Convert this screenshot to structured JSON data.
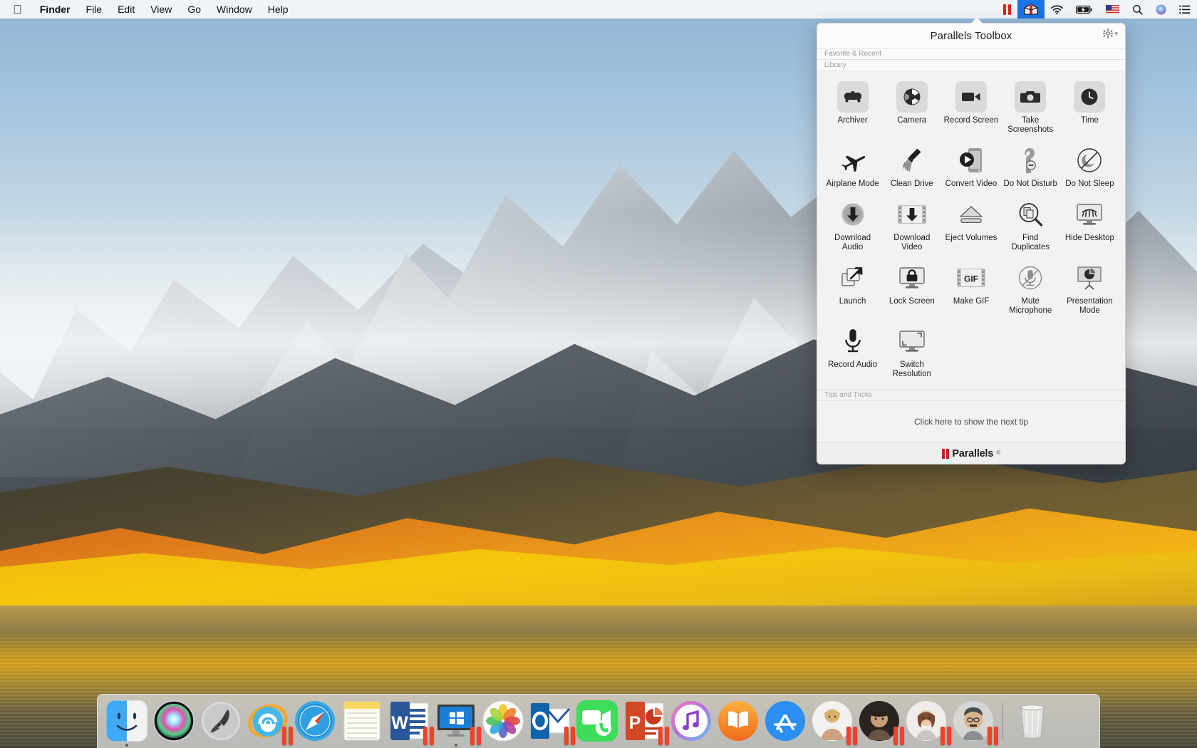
{
  "menubar": {
    "apple_icon": "apple-logo-icon",
    "items": [
      {
        "label": "Finder",
        "bold": true
      },
      {
        "label": "File",
        "bold": false
      },
      {
        "label": "Edit",
        "bold": false
      },
      {
        "label": "View",
        "bold": false
      },
      {
        "label": "Go",
        "bold": false
      },
      {
        "label": "Window",
        "bold": false
      },
      {
        "label": "Help",
        "bold": false
      }
    ],
    "status_items": [
      {
        "name": "parallels-bars-icon",
        "glyph": ""
      },
      {
        "name": "parallels-toolbox-menu-icon",
        "glyph": "",
        "active": true
      },
      {
        "name": "wifi-icon",
        "glyph": "●"
      },
      {
        "name": "battery-charging-icon",
        "glyph": ""
      },
      {
        "name": "input-flag-us-icon",
        "glyph": ""
      },
      {
        "name": "spotlight-search-icon",
        "glyph": "⚲"
      },
      {
        "name": "siri-icon",
        "glyph": ""
      },
      {
        "name": "notification-center-icon",
        "glyph": "☰"
      }
    ]
  },
  "toolbox": {
    "title": "Parallels Toolbox",
    "gear_label": "⚙",
    "gear_chevron": "▾",
    "sections": [
      {
        "label": "Favorite & Recent"
      },
      {
        "label": "Library"
      }
    ],
    "tools": [
      {
        "label": "Archiver",
        "icon": "archiver-icon",
        "tile": true
      },
      {
        "label": "Camera",
        "icon": "camera-shutter-icon",
        "tile": true
      },
      {
        "label": "Record Screen",
        "icon": "video-camera-icon",
        "tile": true
      },
      {
        "label": "Take Screenshots",
        "icon": "photo-camera-icon",
        "tile": true
      },
      {
        "label": "Time",
        "icon": "clock-icon",
        "tile": true
      },
      {
        "label": "Airplane Mode",
        "icon": "airplane-icon",
        "tile": false
      },
      {
        "label": "Clean Drive",
        "icon": "broom-icon",
        "tile": false
      },
      {
        "label": "Convert Video",
        "icon": "phone-play-icon",
        "tile": false
      },
      {
        "label": "Do Not Disturb",
        "icon": "door-hanger-icon",
        "tile": false
      },
      {
        "label": "Do Not Sleep",
        "icon": "crossed-moon-icon",
        "tile": false
      },
      {
        "label": "Download Audio",
        "icon": "download-audio-icon",
        "tile": false
      },
      {
        "label": "Download Video",
        "icon": "download-film-icon",
        "tile": false
      },
      {
        "label": "Eject Volumes",
        "icon": "eject-icon",
        "tile": false
      },
      {
        "label": "Find Duplicates",
        "icon": "magnifier-files-icon",
        "tile": false
      },
      {
        "label": "Hide Desktop",
        "icon": "monitor-eye-icon",
        "tile": false
      },
      {
        "label": "Launch",
        "icon": "launch-arrow-icon",
        "tile": false
      },
      {
        "label": "Lock Screen",
        "icon": "monitor-lock-icon",
        "tile": false
      },
      {
        "label": "Make GIF",
        "icon": "gif-film-icon",
        "tile": false
      },
      {
        "label": "Mute Microphone",
        "icon": "mic-muted-icon",
        "tile": false
      },
      {
        "label": "Presentation Mode",
        "icon": "presentation-icon",
        "tile": false
      },
      {
        "label": "Record Audio",
        "icon": "microphone-icon",
        "tile": false
      },
      {
        "label": "Switch Resolution",
        "icon": "monitor-resize-icon",
        "tile": false
      }
    ],
    "tips": {
      "header": "Tips and Tricks",
      "body": "Click here to show the next tip"
    },
    "footer": {
      "brand": "Parallels",
      "trademark": "®"
    }
  },
  "dock": {
    "items": [
      {
        "name": "finder",
        "label": "Finder",
        "icon": "finder-icon",
        "running": true,
        "badge": false
      },
      {
        "name": "siri",
        "label": "Siri",
        "icon": "siri-icon",
        "running": false,
        "badge": false
      },
      {
        "name": "launchpad",
        "label": "Launchpad",
        "icon": "launchpad-icon",
        "running": false,
        "badge": false
      },
      {
        "name": "ie",
        "label": "Internet Explorer",
        "icon": "internet-explorer-icon",
        "running": false,
        "badge": true
      },
      {
        "name": "safari",
        "label": "Safari",
        "icon": "safari-icon",
        "running": false,
        "badge": false
      },
      {
        "name": "notes",
        "label": "Notes",
        "icon": "notes-icon",
        "running": false,
        "badge": false
      },
      {
        "name": "word",
        "label": "Word",
        "icon": "microsoft-word-icon",
        "running": false,
        "badge": true
      },
      {
        "name": "windows-vm",
        "label": "Windows",
        "icon": "windows-vm-icon",
        "running": true,
        "badge": true
      },
      {
        "name": "photos",
        "label": "Photos",
        "icon": "photos-icon",
        "running": false,
        "badge": false
      },
      {
        "name": "outlook",
        "label": "Outlook",
        "icon": "microsoft-outlook-icon",
        "running": false,
        "badge": true
      },
      {
        "name": "facetime",
        "label": "FaceTime",
        "icon": "facetime-icon",
        "running": false,
        "badge": false
      },
      {
        "name": "powerpoint",
        "label": "PowerPoint",
        "icon": "microsoft-powerpoint-icon",
        "running": false,
        "badge": true
      },
      {
        "name": "itunes",
        "label": "iTunes",
        "icon": "itunes-icon",
        "running": false,
        "badge": false
      },
      {
        "name": "ibooks",
        "label": "iBooks",
        "icon": "ibooks-icon",
        "running": false,
        "badge": false
      },
      {
        "name": "appstore",
        "label": "App Store",
        "icon": "app-store-icon",
        "running": false,
        "badge": false
      },
      {
        "name": "contact-1",
        "label": "Contact",
        "icon": "avatar-icon",
        "running": false,
        "badge": true
      },
      {
        "name": "contact-2",
        "label": "Contact",
        "icon": "avatar-icon",
        "running": false,
        "badge": true
      },
      {
        "name": "contact-3",
        "label": "Contact",
        "icon": "avatar-icon",
        "running": false,
        "badge": true
      },
      {
        "name": "contact-4",
        "label": "Contact",
        "icon": "avatar-icon",
        "running": false,
        "badge": true
      }
    ],
    "trash": {
      "name": "trash",
      "label": "Trash",
      "icon": "trash-icon"
    }
  },
  "colors": {
    "accent_red": "#e02020",
    "menubar_bg": "#f8f8f8",
    "panel_bg": "#f2f2f2",
    "highlight_blue": "#1a74e8"
  }
}
